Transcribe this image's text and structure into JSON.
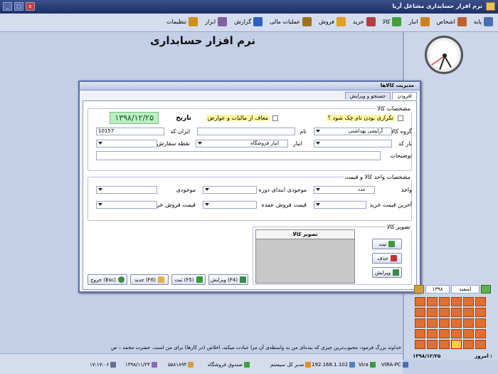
{
  "window": {
    "title": "نرم افزار حسابداری مشاغل آریا",
    "min": "_",
    "max": "□",
    "close": "x"
  },
  "menu": [
    {
      "label": "پایه",
      "icon": "base-icon",
      "color": "#4a6fb0"
    },
    {
      "label": "اشخاص",
      "icon": "people-icon",
      "color": "#c06030"
    },
    {
      "label": "انبار",
      "icon": "warehouse-icon",
      "color": "#d08020"
    },
    {
      "label": "کالا",
      "icon": "goods-icon",
      "color": "#40a040"
    },
    {
      "label": "خرید",
      "icon": "purchase-icon",
      "color": "#b04040"
    },
    {
      "label": "فروش",
      "icon": "sales-icon",
      "color": "#e0a020"
    },
    {
      "label": "عملیات مالی",
      "icon": "finance-icon",
      "color": "#a07020"
    },
    {
      "label": "گزارش",
      "icon": "report-icon",
      "color": "#3060c0"
    },
    {
      "label": "ابزار",
      "icon": "tools-icon",
      "color": "#8060a0"
    },
    {
      "label": "تنظیمات",
      "icon": "settings-icon",
      "color": "#d09010"
    }
  ],
  "app_title": "نرم افزار حسابداری",
  "dialog": {
    "title": "مدیریت کالاها",
    "tabs": [
      "افزودن",
      "جستجو و ویرایش"
    ],
    "section1": {
      "legend": "مشخصات کالا",
      "dup_check": "تکراری بودن نام چک شود ؟",
      "tax_exempt": "معاف از مالیات و عوارض",
      "date_label": "تاریخ",
      "date_value": "۱۳۹۸/۱۲/۲۵",
      "group_label": "گروه کالا",
      "group_value": "آرایشی بهداشتی",
      "name_label": "نام",
      "name_value": "",
      "code_label": "ایران کد",
      "code_value": "10157",
      "barcode_label": "بار کد",
      "warehouse_label": "انبار",
      "warehouse_value": "انبار فروشگاه",
      "order_point_label": "نقطه سفارش",
      "desc_label": "توضیحات"
    },
    "section2": {
      "legend": "مشخصات واحد کالا و قیمت",
      "unit_label": "واحد",
      "unit_value": "عدد",
      "opening_stock_label": "موجودی ابتدای دوره",
      "stock_label": "موجودی",
      "last_buy_label": "آخرین قیمت خرید",
      "wholesale_label": "قیمت فروش عمده",
      "retail_label": "قیمت فروش خرده"
    },
    "section3": {
      "legend": "تصویر کالا",
      "image_col": "تصویر کالا",
      "btn_save": "ثبت",
      "btn_delete": "حذف",
      "btn_edit": "ویرایش"
    },
    "footer": {
      "edit": "ویرایش (F4)",
      "save": "ثبت (F5)",
      "new": "جدید (F6)",
      "exit": "خروج (Esc)"
    }
  },
  "calendar": {
    "year": "۱۳۹۸",
    "month": "اسفند",
    "today_label": "امروز :",
    "today": "۱۳۹۸/۱۲/۲۵"
  },
  "status": {
    "quote": "خداوند بزرگ فرمود: محبوب‌ترین چیزی که بنده‌ای من به واسطه‌ی آن مرا عبادت میکند، اخلاص (در کارها) برای من است. حضرت محمد – ص",
    "computer": "VIRA-PC",
    "ip": "192.168.1.102",
    "user": "Vira",
    "role": "مدیر کل سیستم",
    "cashbox": "صندوق فروشگاه",
    "code": "۵۵۸۱۸۹۴",
    "date": "۱۳۹۸/۱۱/۲۴",
    "time": "۱۷:۱۷:۰۶"
  }
}
